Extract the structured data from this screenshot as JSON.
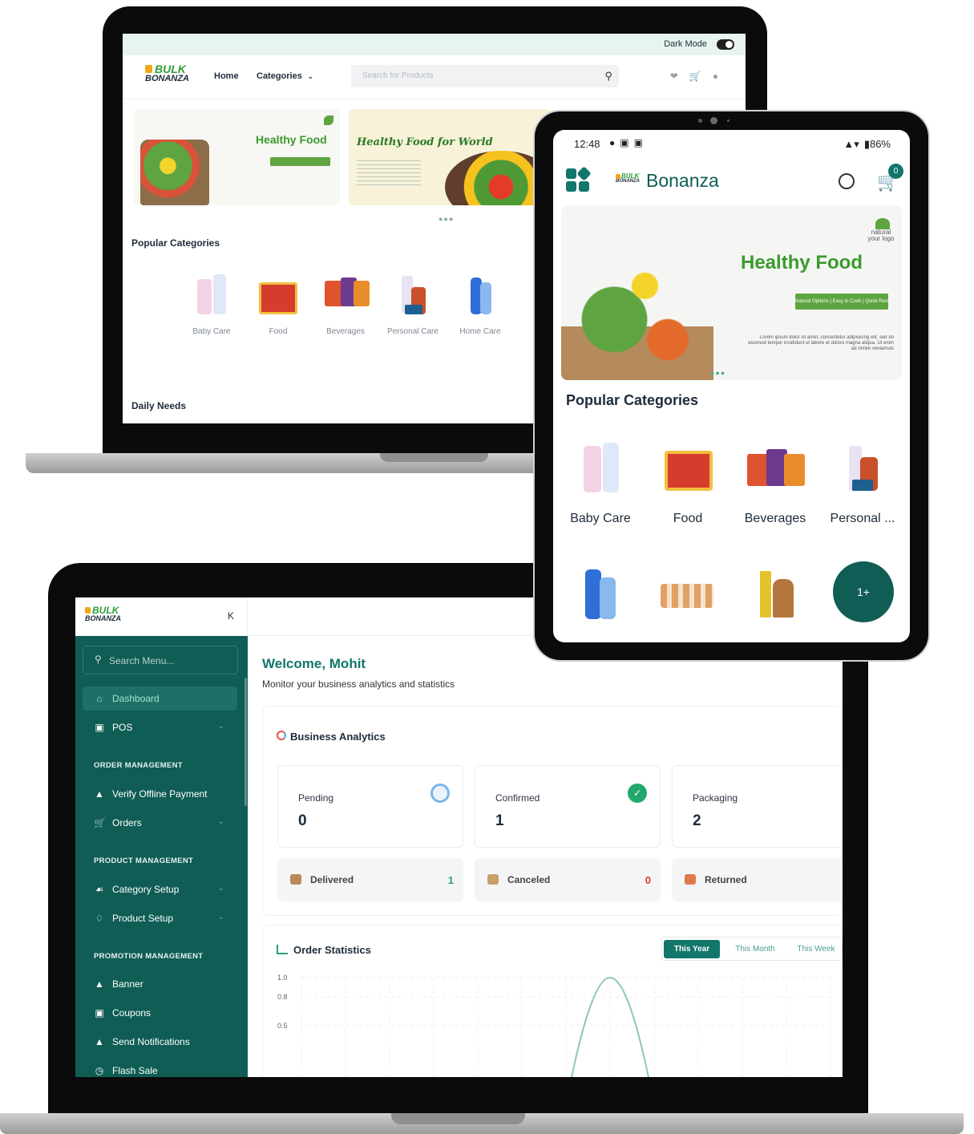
{
  "storefront": {
    "dark_mode_label": "Dark Mode",
    "logo_top": "BULK",
    "logo_bottom": "BONANZA",
    "nav": {
      "home": "Home",
      "categories": "Categories"
    },
    "search": {
      "placeholder": "Search for Products"
    },
    "banners": [
      {
        "title": "Healthy Food",
        "tagline": "Natural Options | Easy to Cook | Quick Recipes"
      },
      {
        "title": "Healthy Food for World"
      }
    ],
    "popular_categories_title": "Popular Categories",
    "categories": [
      "Baby Care",
      "Food",
      "Beverages",
      "Personal Care",
      "Home Care"
    ],
    "daily_needs_title": "Daily Needs"
  },
  "admin": {
    "logo_top": "BULK",
    "logo_bottom": "BONANZA",
    "collapse_glyph": "K",
    "menu_search": {
      "placeholder": "Search Menu..."
    },
    "menu": {
      "dashboard": "Dashboard",
      "pos": "POS",
      "order_heading": "ORDER MANAGEMENT",
      "verify_offline_payment": "Verify Offline Payment",
      "orders": "Orders",
      "product_heading": "PRODUCT MANAGEMENT",
      "category_setup": "Category Setup",
      "product_setup": "Product Setup",
      "promotion_heading": "PROMOTION MANAGEMENT",
      "banner": "Banner",
      "coupons": "Coupons",
      "send_notifications": "Send Notifications",
      "flash_sale": "Flash Sale"
    },
    "welcome": "Welcome, Mohit",
    "welcome_sub": "Monitor your business analytics and statistics",
    "business_analytics_title": "Business Analytics",
    "stats": [
      {
        "label": "Pending",
        "value": "0"
      },
      {
        "label": "Confirmed",
        "value": "1"
      },
      {
        "label": "Packaging",
        "value": "2"
      }
    ],
    "small_stats": [
      {
        "label": "Delivered",
        "value": "1"
      },
      {
        "label": "Canceled",
        "value": "0"
      },
      {
        "label": "Returned",
        "value": ""
      }
    ],
    "order_statistics_title": "Order Statistics",
    "range_tabs": {
      "year": "This Year",
      "month": "This Month",
      "week": "This Week"
    },
    "colors": {
      "sidebar": "#0f5d55",
      "accent": "#12766a",
      "delivered": "#2aa17a",
      "canceled": "#e23b3b"
    }
  },
  "chart_data": {
    "type": "line",
    "y_ticks": [
      "1.0",
      "0.8",
      "0.5"
    ],
    "ylim": [
      0,
      1.0
    ],
    "grid": true,
    "series": [
      {
        "points": [
          [
            0,
            0
          ],
          [
            6,
            0
          ],
          [
            7,
            1.0
          ],
          [
            8,
            0
          ],
          [
            12,
            0
          ]
        ]
      }
    ],
    "xlim": [
      0,
      12
    ],
    "line_color": "#8cc7c0"
  },
  "mobile": {
    "status": {
      "time": "12:48",
      "battery": "86%"
    },
    "brand_small_top": "BULK",
    "brand_small_bottom": "BONANZA",
    "app_title": "Bonanza",
    "cart_count": "0",
    "banner": {
      "title": "Healthy Food",
      "tagline": "Natural Options | Easy to Cook | Quick Recipes",
      "logo_text": "natural your logo",
      "body": "Lorem ipsum dolor sit amet, consectetur adipisicing elit, sed do eiusmod tempor incididunt ut labore et dolore magna aliqua. Ut enim ad minim veniamuis"
    },
    "popular_categories_title": "Popular Categories",
    "categories": [
      "Baby Care",
      "Food",
      "Beverages",
      "Personal ..."
    ],
    "more_button": "1+"
  }
}
